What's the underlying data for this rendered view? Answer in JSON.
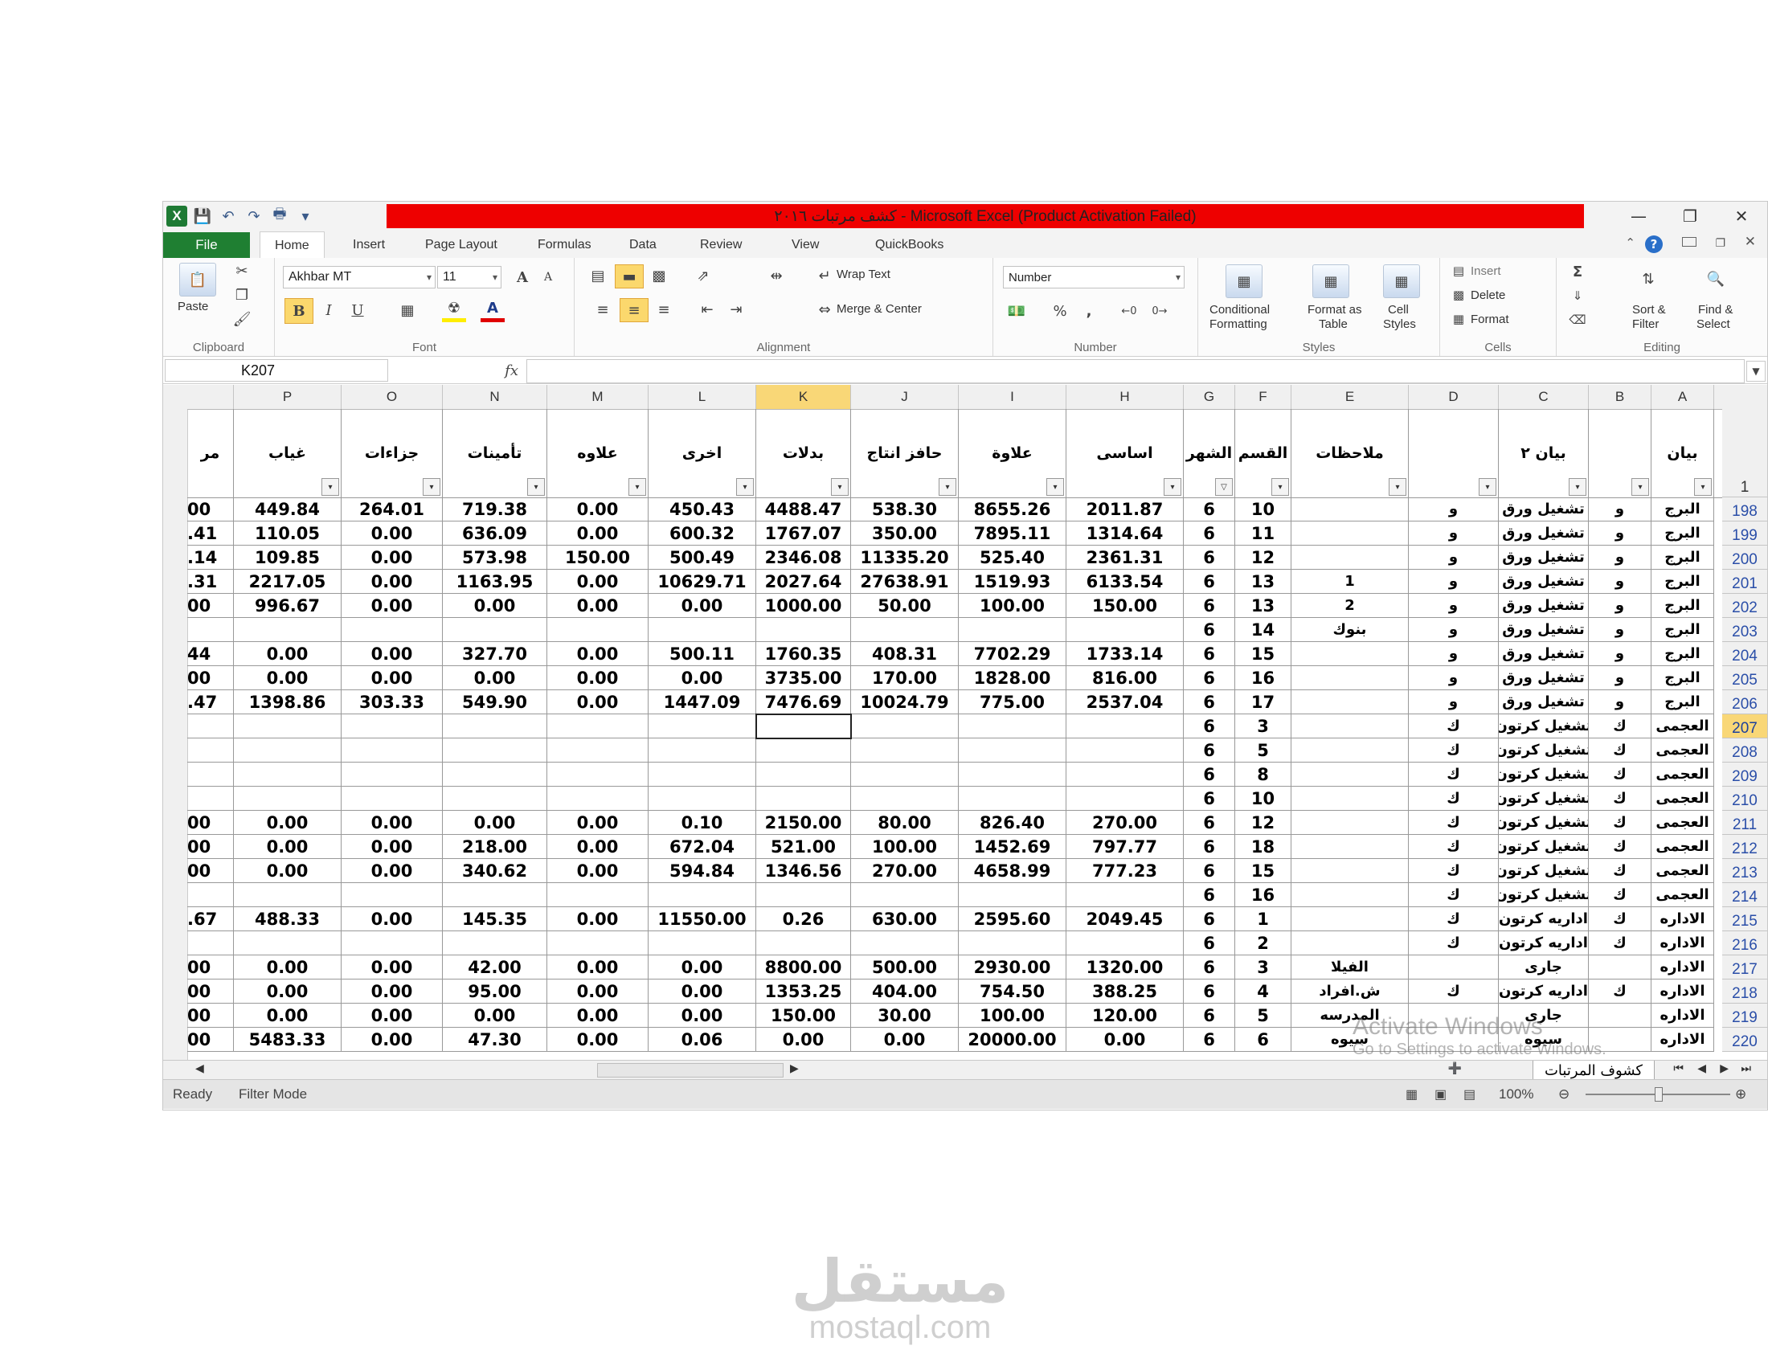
{
  "window": {
    "title": "كشف مرتبات ٢٠١٦ - Microsoft Excel (Product Activation Failed)",
    "title_bar_color": "#ee0000"
  },
  "quick_access": [
    "excel-logo-icon",
    "save-icon",
    "undo-icon",
    "redo-icon",
    "print-preview-icon",
    "customize-icon"
  ],
  "excel_logo_letter": "X",
  "tabs": {
    "file": "File",
    "items": [
      "Home",
      "Insert",
      "Page Layout",
      "Formulas",
      "Data",
      "Review",
      "View",
      "QuickBooks"
    ],
    "active": "Home"
  },
  "ribbon": {
    "clipboard": {
      "label": "Clipboard",
      "paste": "Paste"
    },
    "font": {
      "label": "Font",
      "name": "Akhbar MT",
      "size": "11",
      "bold": "B",
      "italic": "I",
      "underline": "U",
      "grow": "A",
      "shrink": "A",
      "font_color_letter": "A"
    },
    "alignment": {
      "label": "Alignment",
      "wrap_text": "Wrap Text",
      "merge_center": "Merge & Center"
    },
    "number": {
      "label": "Number",
      "format": "Number",
      "percent": "%",
      "comma": ","
    },
    "styles": {
      "label": "Styles",
      "conditional": "Conditional",
      "formatting": "Formatting",
      "format_as": "Format as",
      "table": "Table",
      "cell": "Cell",
      "cell_styles": "Styles"
    },
    "cells": {
      "label": "Cells",
      "insert": "Insert",
      "delete": "Delete",
      "format": "Format"
    },
    "editing": {
      "label": "Editing",
      "sum": "Σ",
      "sort": "Sort &",
      "filter": "Filter",
      "find": "Find &",
      "select": "Select"
    }
  },
  "formula_bar": {
    "name_box": "K207",
    "fx": "fx",
    "value": ""
  },
  "columns": [
    {
      "letter": "",
      "header": "مر"
    },
    {
      "letter": "P",
      "header": "غياب"
    },
    {
      "letter": "O",
      "header": "جزاءات"
    },
    {
      "letter": "N",
      "header": "تأمينات"
    },
    {
      "letter": "M",
      "header": "علاوه"
    },
    {
      "letter": "L",
      "header": "اخرى"
    },
    {
      "letter": "K",
      "header": "بدلات"
    },
    {
      "letter": "J",
      "header": "حافز انتاج"
    },
    {
      "letter": "I",
      "header": "علاوة"
    },
    {
      "letter": "H",
      "header": "اساسى"
    },
    {
      "letter": "G",
      "header": "الشهر"
    },
    {
      "letter": "F",
      "header": "القسم"
    },
    {
      "letter": "E",
      "header": "ملاحظات"
    },
    {
      "letter": "D",
      "header": ""
    },
    {
      "letter": "C",
      "header": "بيان ٢"
    },
    {
      "letter": "B",
      "header": ""
    },
    {
      "letter": "A",
      "header": "بيان"
    }
  ],
  "header_row_number": "1",
  "selected_column": "K",
  "selected_row": "207",
  "rows": [
    {
      "n": "198",
      "c": [
        "00",
        "449.84",
        "264.01",
        "719.38",
        "0.00",
        "450.43",
        "4488.47",
        "538.30",
        "8655.26",
        "2011.87",
        "6",
        "10",
        "",
        "و",
        "تشغيل ورق",
        "و",
        "البرج"
      ]
    },
    {
      "n": "199",
      "c": [
        ".41",
        "110.05",
        "0.00",
        "636.09",
        "0.00",
        "600.32",
        "1767.07",
        "350.00",
        "7895.11",
        "1314.64",
        "6",
        "11",
        "",
        "و",
        "تشغيل ورق",
        "و",
        "البرج"
      ]
    },
    {
      "n": "200",
      "c": [
        ".14",
        "109.85",
        "0.00",
        "573.98",
        "150.00",
        "500.49",
        "2346.08",
        "11335.20",
        "525.40",
        "2361.31",
        "6",
        "12",
        "",
        "و",
        "تشغيل ورق",
        "و",
        "البرج"
      ]
    },
    {
      "n": "201",
      "c": [
        ".31",
        "2217.05",
        "0.00",
        "1163.95",
        "0.00",
        "10629.71",
        "2027.64",
        "27638.91",
        "1519.93",
        "6133.54",
        "6",
        "13",
        "1",
        "و",
        "تشغيل ورق",
        "و",
        "البرج"
      ]
    },
    {
      "n": "202",
      "c": [
        "00",
        "996.67",
        "0.00",
        "0.00",
        "0.00",
        "0.00",
        "1000.00",
        "50.00",
        "100.00",
        "150.00",
        "6",
        "13",
        "2",
        "و",
        "تشغيل ورق",
        "و",
        "البرج"
      ]
    },
    {
      "n": "203",
      "c": [
        "",
        "",
        "",
        "",
        "",
        "",
        "",
        "",
        "",
        "",
        "6",
        "14",
        "بنوك",
        "و",
        "تشغيل ورق",
        "و",
        "البرج"
      ]
    },
    {
      "n": "204",
      "c": [
        "44",
        "0.00",
        "0.00",
        "327.70",
        "0.00",
        "500.11",
        "1760.35",
        "408.31",
        "7702.29",
        "1733.14",
        "6",
        "15",
        "",
        "و",
        "تشغيل ورق",
        "و",
        "البرج"
      ]
    },
    {
      "n": "205",
      "c": [
        "00",
        "0.00",
        "0.00",
        "0.00",
        "0.00",
        "0.00",
        "3735.00",
        "170.00",
        "1828.00",
        "816.00",
        "6",
        "16",
        "",
        "و",
        "تشغيل ورق",
        "و",
        "البرج"
      ]
    },
    {
      "n": "206",
      "c": [
        ".47",
        "1398.86",
        "303.33",
        "549.90",
        "0.00",
        "1447.09",
        "7476.69",
        "10024.79",
        "775.00",
        "2537.04",
        "6",
        "17",
        "",
        "و",
        "تشغيل ورق",
        "و",
        "البرج"
      ]
    },
    {
      "n": "207",
      "c": [
        "",
        "",
        "",
        "",
        "",
        "",
        "",
        "",
        "",
        "",
        "6",
        "3",
        "",
        "ك",
        "تشغيل كرتون",
        "ك",
        "العجمى"
      ]
    },
    {
      "n": "208",
      "c": [
        "",
        "",
        "",
        "",
        "",
        "",
        "",
        "",
        "",
        "",
        "6",
        "5",
        "",
        "ك",
        "تشغيل كرتون",
        "ك",
        "العجمى"
      ]
    },
    {
      "n": "209",
      "c": [
        "",
        "",
        "",
        "",
        "",
        "",
        "",
        "",
        "",
        "",
        "6",
        "8",
        "",
        "ك",
        "تشغيل كرتون",
        "ك",
        "العجمى"
      ]
    },
    {
      "n": "210",
      "c": [
        "",
        "",
        "",
        "",
        "",
        "",
        "",
        "",
        "",
        "",
        "6",
        "10",
        "",
        "ك",
        "تشغيل كرتون",
        "ك",
        "العجمى"
      ]
    },
    {
      "n": "211",
      "c": [
        "00",
        "0.00",
        "0.00",
        "0.00",
        "0.00",
        "0.10",
        "2150.00",
        "80.00",
        "826.40",
        "270.00",
        "6",
        "12",
        "",
        "ك",
        "تشغيل كرتون",
        "ك",
        "العجمى"
      ]
    },
    {
      "n": "212",
      "c": [
        "00",
        "0.00",
        "0.00",
        "218.00",
        "0.00",
        "672.04",
        "521.00",
        "100.00",
        "1452.69",
        "797.77",
        "6",
        "18",
        "",
        "ك",
        "تشغيل كرتون",
        "ك",
        "العجمى"
      ]
    },
    {
      "n": "213",
      "c": [
        "00",
        "0.00",
        "0.00",
        "340.62",
        "0.00",
        "594.84",
        "1346.56",
        "270.00",
        "4658.99",
        "777.23",
        "6",
        "15",
        "",
        "ك",
        "تشغيل كرتون",
        "ك",
        "العجمى"
      ]
    },
    {
      "n": "214",
      "c": [
        "",
        "",
        "",
        "",
        "",
        "",
        "",
        "",
        "",
        "",
        "6",
        "16",
        "",
        "ك",
        "تشغيل كرتون",
        "ك",
        "العجمى"
      ]
    },
    {
      "n": "215",
      "c": [
        ".67",
        "488.33",
        "0.00",
        "145.35",
        "0.00",
        "11550.00",
        "0.26",
        "630.00",
        "2595.60",
        "2049.45",
        "6",
        "1",
        "",
        "ك",
        "اداريه كرتون",
        "ك",
        "الاداره"
      ]
    },
    {
      "n": "216",
      "c": [
        "",
        "",
        "",
        "",
        "",
        "",
        "",
        "",
        "",
        "",
        "6",
        "2",
        "",
        "ك",
        "اداريه كرتون",
        "ك",
        "الاداره"
      ]
    },
    {
      "n": "217",
      "c": [
        "00",
        "0.00",
        "0.00",
        "42.00",
        "0.00",
        "0.00",
        "8800.00",
        "500.00",
        "2930.00",
        "1320.00",
        "6",
        "3",
        "الفيلا",
        "",
        "جارى",
        "",
        "الاداره"
      ]
    },
    {
      "n": "218",
      "c": [
        "00",
        "0.00",
        "0.00",
        "95.00",
        "0.00",
        "0.00",
        "1353.25",
        "404.00",
        "754.50",
        "388.25",
        "6",
        "4",
        "ش.افراد",
        "ك",
        "اداريه كرتون",
        "ك",
        "الاداره"
      ]
    },
    {
      "n": "219",
      "c": [
        "00",
        "0.00",
        "0.00",
        "0.00",
        "0.00",
        "0.00",
        "150.00",
        "30.00",
        "100.00",
        "120.00",
        "6",
        "5",
        "المدرسه",
        "",
        "جارى",
        "",
        "الاداره"
      ]
    },
    {
      "n": "220",
      "c": [
        "00",
        "5483.33",
        "0.00",
        "47.30",
        "0.00",
        "0.06",
        "0.00",
        "0.00",
        "20000.00",
        "0.00",
        "6",
        "6",
        "سيوه",
        "",
        "سيوه",
        "",
        "الاداره"
      ]
    }
  ],
  "sheet_tab": "كشوف المرتبات",
  "status": {
    "ready": "Ready",
    "mode": "Filter Mode",
    "zoom": "100%"
  },
  "activation": {
    "line1": "Activate Windows",
    "line2": "Go to Settings to activate Windows."
  },
  "watermark": {
    "arabic": "مستقل",
    "latin": "mostaql.com"
  }
}
